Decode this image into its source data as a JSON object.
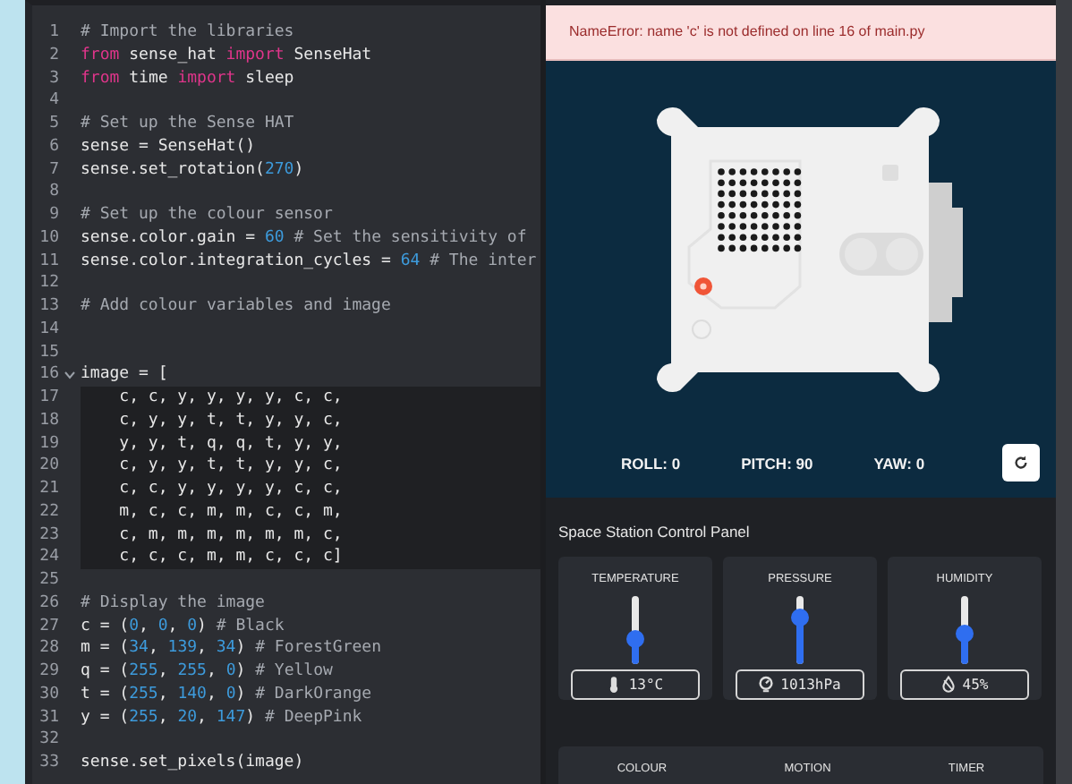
{
  "editor": {
    "lines": [
      {
        "number": "1",
        "tokens": [
          {
            "kind": "comment",
            "text": "# Import the libraries"
          }
        ]
      },
      {
        "number": "2",
        "tokens": [
          {
            "kind": "keyword",
            "text": "from"
          },
          {
            "kind": "plain",
            "text": " sense_hat "
          },
          {
            "kind": "keyword",
            "text": "import"
          },
          {
            "kind": "plain",
            "text": " SenseHat"
          }
        ]
      },
      {
        "number": "3",
        "tokens": [
          {
            "kind": "keyword",
            "text": "from"
          },
          {
            "kind": "plain",
            "text": " time "
          },
          {
            "kind": "keyword",
            "text": "import"
          },
          {
            "kind": "plain",
            "text": " sleep"
          }
        ]
      },
      {
        "number": "4"
      },
      {
        "number": "5",
        "tokens": [
          {
            "kind": "comment",
            "text": "# Set up the Sense HAT"
          }
        ]
      },
      {
        "number": "6",
        "tokens": [
          {
            "kind": "plain",
            "text": "sense = SenseHat()"
          }
        ]
      },
      {
        "number": "7",
        "tokens": [
          {
            "kind": "plain",
            "text": "sense.set_rotation("
          },
          {
            "kind": "number",
            "text": "270"
          },
          {
            "kind": "plain",
            "text": ")"
          }
        ]
      },
      {
        "number": "8"
      },
      {
        "number": "9",
        "tokens": [
          {
            "kind": "comment",
            "text": "# Set up the colour sensor"
          }
        ]
      },
      {
        "number": "10",
        "tokens": [
          {
            "kind": "plain",
            "text": "sense.color.gain = "
          },
          {
            "kind": "number",
            "text": "60"
          },
          {
            "kind": "comment",
            "text": " # Set the sensitivity of"
          }
        ]
      },
      {
        "number": "11",
        "tokens": [
          {
            "kind": "plain",
            "text": "sense.color.integration_cycles = "
          },
          {
            "kind": "number",
            "text": "64"
          },
          {
            "kind": "comment",
            "text": " # The inter"
          }
        ]
      },
      {
        "number": "12"
      },
      {
        "number": "13",
        "tokens": [
          {
            "kind": "comment",
            "text": "# Add colour variables and image"
          }
        ]
      },
      {
        "number": "14"
      },
      {
        "number": "15"
      },
      {
        "number": "16",
        "foldable": true,
        "tokens": [
          {
            "kind": "plain",
            "text": "image = ["
          }
        ]
      },
      {
        "number": "17",
        "highlighted": true,
        "tokens": [
          {
            "kind": "plain",
            "text": "    c, c, y, y, y, y, c, c,"
          }
        ]
      },
      {
        "number": "18",
        "highlighted": true,
        "tokens": [
          {
            "kind": "plain",
            "text": "    c, y, y, t, t, y, y, c,"
          }
        ]
      },
      {
        "number": "19",
        "highlighted": true,
        "tokens": [
          {
            "kind": "plain",
            "text": "    y, y, t, q, q, t, y, y,"
          }
        ]
      },
      {
        "number": "20",
        "highlighted": true,
        "tokens": [
          {
            "kind": "plain",
            "text": "    c, y, y, t, t, y, y, c,"
          }
        ]
      },
      {
        "number": "21",
        "highlighted": true,
        "tokens": [
          {
            "kind": "plain",
            "text": "    c, c, y, y, y, y, c, c,"
          }
        ]
      },
      {
        "number": "22",
        "highlighted": true,
        "tokens": [
          {
            "kind": "plain",
            "text": "    m, c, c, m, m, c, c, m,"
          }
        ]
      },
      {
        "number": "23",
        "highlighted": true,
        "tokens": [
          {
            "kind": "plain",
            "text": "    c, m, m, m, m, m, m, c,"
          }
        ]
      },
      {
        "number": "24",
        "highlighted": true,
        "tokens": [
          {
            "kind": "plain",
            "text": "    c, c, c, m, m, c, c, c]"
          }
        ]
      },
      {
        "number": "25"
      },
      {
        "number": "26",
        "tokens": [
          {
            "kind": "comment",
            "text": "# Display the image"
          }
        ]
      },
      {
        "number": "27",
        "tokens": [
          {
            "kind": "plain",
            "text": "c = ("
          },
          {
            "kind": "number",
            "text": "0"
          },
          {
            "kind": "plain",
            "text": ", "
          },
          {
            "kind": "number",
            "text": "0"
          },
          {
            "kind": "plain",
            "text": ", "
          },
          {
            "kind": "number",
            "text": "0"
          },
          {
            "kind": "plain",
            "text": ")"
          },
          {
            "kind": "comment",
            "text": " # Black"
          }
        ]
      },
      {
        "number": "28",
        "tokens": [
          {
            "kind": "plain",
            "text": "m = ("
          },
          {
            "kind": "number",
            "text": "34"
          },
          {
            "kind": "plain",
            "text": ", "
          },
          {
            "kind": "number",
            "text": "139"
          },
          {
            "kind": "plain",
            "text": ", "
          },
          {
            "kind": "number",
            "text": "34"
          },
          {
            "kind": "plain",
            "text": ")"
          },
          {
            "kind": "comment",
            "text": " # ForestGreen"
          }
        ]
      },
      {
        "number": "29",
        "tokens": [
          {
            "kind": "plain",
            "text": "q = ("
          },
          {
            "kind": "number",
            "text": "255"
          },
          {
            "kind": "plain",
            "text": ", "
          },
          {
            "kind": "number",
            "text": "255"
          },
          {
            "kind": "plain",
            "text": ", "
          },
          {
            "kind": "number",
            "text": "0"
          },
          {
            "kind": "plain",
            "text": ")"
          },
          {
            "kind": "comment",
            "text": " # Yellow"
          }
        ]
      },
      {
        "number": "30",
        "tokens": [
          {
            "kind": "plain",
            "text": "t = ("
          },
          {
            "kind": "number",
            "text": "255"
          },
          {
            "kind": "plain",
            "text": ", "
          },
          {
            "kind": "number",
            "text": "140"
          },
          {
            "kind": "plain",
            "text": ", "
          },
          {
            "kind": "number",
            "text": "0"
          },
          {
            "kind": "plain",
            "text": ")"
          },
          {
            "kind": "comment",
            "text": " # DarkOrange"
          }
        ]
      },
      {
        "number": "31",
        "tokens": [
          {
            "kind": "plain",
            "text": "y = ("
          },
          {
            "kind": "number",
            "text": "255"
          },
          {
            "kind": "plain",
            "text": ", "
          },
          {
            "kind": "number",
            "text": "20"
          },
          {
            "kind": "plain",
            "text": ", "
          },
          {
            "kind": "number",
            "text": "147"
          },
          {
            "kind": "plain",
            "text": ")"
          },
          {
            "kind": "comment",
            "text": " # DeepPink"
          }
        ]
      },
      {
        "number": "32"
      },
      {
        "number": "33",
        "tokens": [
          {
            "kind": "plain",
            "text": "sense.set_pixels(image)"
          }
        ]
      }
    ]
  },
  "error_banner": {
    "message": "NameError: name 'c' is not defined on line 16 of main.py"
  },
  "simulator": {
    "orientation": [
      "ROLL: 0",
      "PITCH: 90",
      "YAW: 0"
    ]
  },
  "control_panel": {
    "title": "Space Station Control Panel",
    "sensors": [
      {
        "kind": "temperature",
        "label": "TEMPERATURE",
        "level": 0.37,
        "reading": "13°C"
      },
      {
        "kind": "pressure",
        "label": "PRESSURE",
        "level": 0.7,
        "reading": "1013hPa"
      },
      {
        "kind": "humidity",
        "label": "HUMIDITY",
        "level": 0.46,
        "reading": "45%"
      }
    ],
    "sections": [
      "COLOUR",
      "MOTION",
      "TIMER"
    ]
  }
}
